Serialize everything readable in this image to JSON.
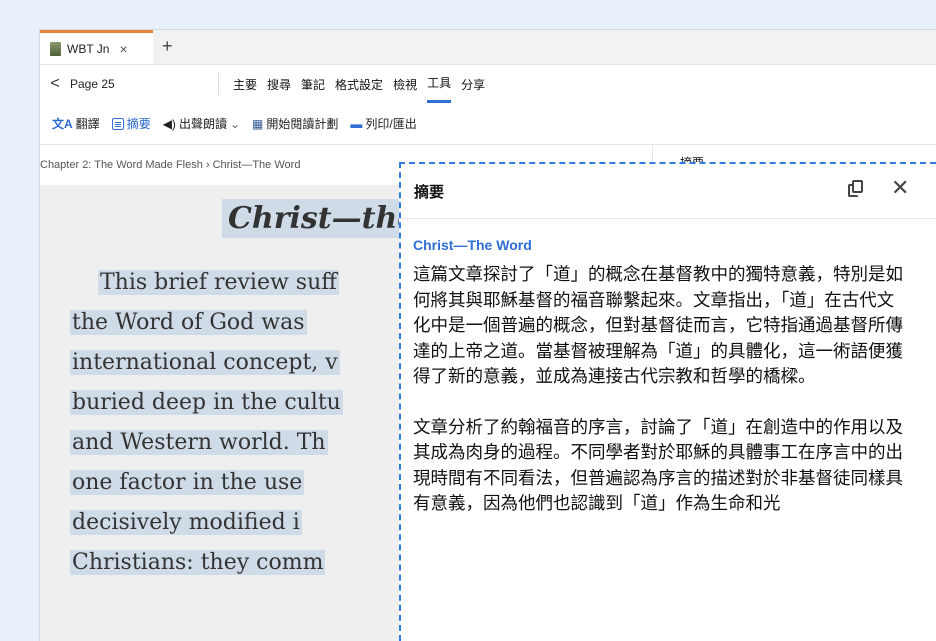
{
  "tab": {
    "title": "WBT Jn",
    "close": "×",
    "add": "+"
  },
  "nav": {
    "back": "<",
    "page": "Page 25",
    "menu": [
      "主要",
      "搜尋",
      "筆記",
      "格式設定",
      "檢視",
      "工具",
      "分享"
    ],
    "active_menu": "工具"
  },
  "toolbar": {
    "translate": "翻譯",
    "summary": "摘要",
    "read_aloud": "出聲朗讀",
    "read_aloud_caret": "⌄",
    "reading_plan": "開始閱讀計劃",
    "print": "列印/匯出"
  },
  "breadcrumb": "Chapter 2: The Word Made Flesh › Christ—The Word",
  "right_panel_heading": "摘要",
  "reader": {
    "title": "Christ—the",
    "lines": [
      "This brief review suff",
      "the Word of God was",
      "international concept, v",
      "buried deep in the cultu",
      "and Western world. Th",
      "one factor in the use",
      "decisively modified i",
      "Christians: they comm"
    ]
  },
  "summary": {
    "title": "摘要",
    "close": "✕",
    "article_title": "Christ—The Word",
    "paragraphs": [
      "這篇文章探討了「道」的概念在基督教中的獨特意義，特別是如何將其與耶穌基督的福音聯繫起來。文章指出，「道」在古代文化中是一個普遍的概念，但對基督徒而言，它特指通過基督所傳達的上帝之道。當基督被理解為「道」的具體化，這一術語便獲得了新的意義，並成為連接古代宗教和哲學的橋樑。",
      "文章分析了約翰福音的序言，討論了「道」在創造中的作用以及其成為肉身的過程。不同學者對於耶穌的具體事工在序言中的出現時間有不同看法，但普遍認為序言的描述對於非基督徒同樣具有意義，因為他們也認識到「道」作為生命和光"
    ]
  },
  "colors": {
    "accent": "#2f6fd6",
    "tab_accent": "#e8833a",
    "highlight": "#cfdce8",
    "dashed_border": "#2f7be0"
  }
}
